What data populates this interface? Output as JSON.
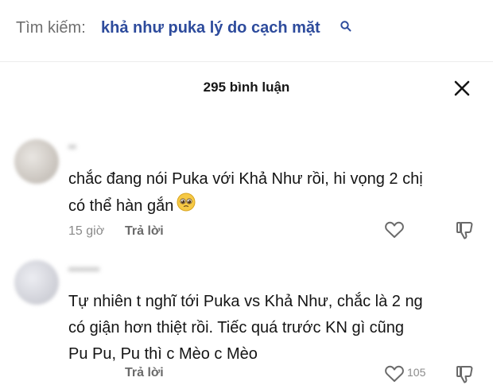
{
  "search": {
    "label": "Tìm kiếm:",
    "query": "khả như puka lý do cạch mặt",
    "icon": "search-icon"
  },
  "comments_header": {
    "title": "295 bình luận",
    "close_icon": "close-icon"
  },
  "comments": [
    {
      "username": "••",
      "text_line1": "chắc đang nói Puka với Khả Như rồi, hi vọng 2 chị",
      "text_line2": "có thể hàn gắn",
      "emoji": "pleading-face",
      "time": "15 giờ",
      "reply_label": "Trả lời"
    },
    {
      "username": "••••••••",
      "text_line1": "Tự nhiên t nghĩ tới Puka vs Khả Như, chắc là 2 ng",
      "text_line2": "có giận hơn thiệt rồi. Tiếc quá trước KN gì cũng",
      "text_line3": "Pu Pu, Pu thì c Mèo c Mèo",
      "time": "",
      "reply_label": "Trả lời",
      "like_count": "105"
    }
  ],
  "colors": {
    "search_query": "#2d4b9c",
    "muted": "#8a8a8a",
    "text": "#141414"
  }
}
